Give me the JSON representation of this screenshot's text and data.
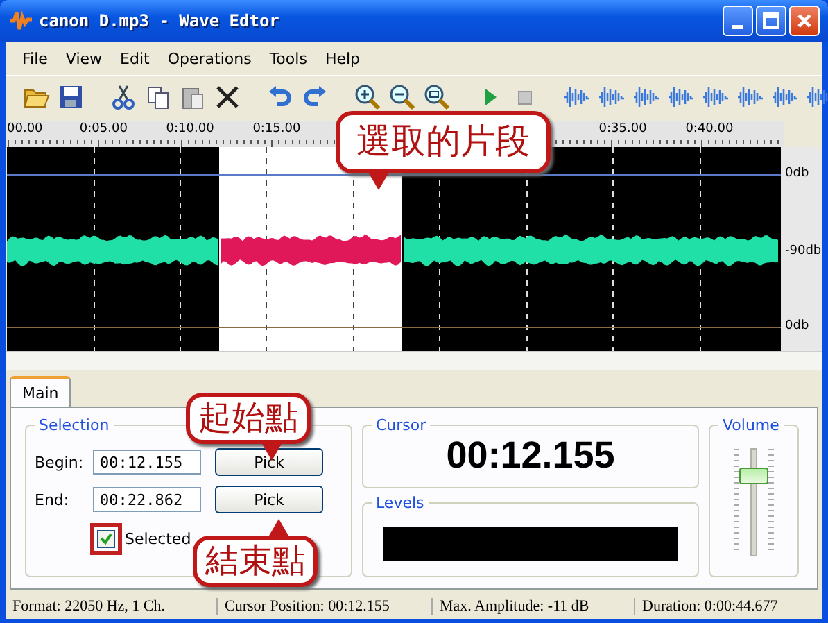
{
  "window": {
    "title": "canon D.mp3 - Wave Edtor"
  },
  "menu": [
    "File",
    "View",
    "Edit",
    "Operations",
    "Tools",
    "Help"
  ],
  "ruler": {
    "left_labels": [
      "00.00",
      "0:05.00",
      "0:10.00",
      "0:15.00"
    ],
    "right_labels": [
      "0:35.00",
      "0:40.00"
    ]
  },
  "db_labels": [
    "0db",
    "-90db",
    "0db"
  ],
  "callouts": {
    "selection": "選取的片段",
    "begin": "起始點",
    "end": "結束點"
  },
  "tabs": [
    {
      "label": "Main",
      "selected": true
    }
  ],
  "selection": {
    "title": "Selection",
    "begin_label": "Begin:",
    "begin_value": "00:12.155",
    "end_label": "End:",
    "end_value": "00:22.862",
    "pick": [
      "Pick",
      "Pick"
    ],
    "selected_label": "Selected",
    "checked": true
  },
  "cursor": {
    "title": "Cursor",
    "value": "00:12.155"
  },
  "levels": {
    "title": "Levels"
  },
  "volume": {
    "title": "Volume",
    "level": 0.77
  },
  "status_bar": [
    "Format: 22050 Hz, 1 Ch.",
    "Cursor Position: 00:12.155",
    "Max. Amplitude: -11 dB",
    "Duration: 0:00:44.677"
  ]
}
